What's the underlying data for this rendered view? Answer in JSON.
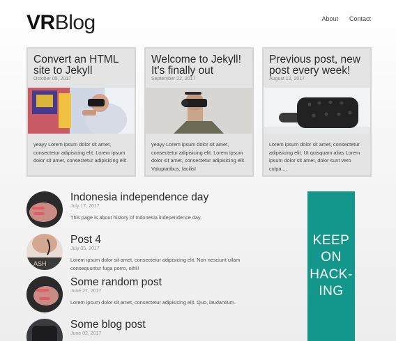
{
  "site": {
    "logo_bold": "VR",
    "logo_light": "Blog"
  },
  "nav": {
    "items": [
      "About",
      "Contact"
    ]
  },
  "featured": [
    {
      "title": "Convert an HTML site to Jekyll",
      "date": "October 05, 2017",
      "excerpt": "yeayy Lorem ipsum dolor sit amet, consectetur adipisicing elit. Lorem ipsum dolor sit amet, consectetur adipisicing elit."
    },
    {
      "title": "Welcome to Jekyll! It's finally out",
      "date": "September 22, 2017",
      "excerpt": "yeayy Lorem ipsum dolor sit amet, consectetur adipisicing elit. Lorem ipsum dolor sit amet, consectetur adipisicing elit. Voluptatibus, facilis!"
    },
    {
      "title": "Previous post, new post every week!",
      "date": "August 12, 2017",
      "excerpt": "Lorem ipsum dolor sit amet, consectetur adipisicing elit. Ut quisquam alias Lorem ipsum dolor sit amet, dolor sunt vero culpa...."
    }
  ],
  "posts": [
    {
      "title": "Indonesia independence day",
      "date": "July 17, 2017",
      "excerpt": "This page is about history of Indonesia independence day."
    },
    {
      "title": "Post 4",
      "date": "July 05, 2017",
      "excerpt": "Lorem ipsum dolor sit amet, consectetur adipisicing elit. Non nesciunt ullam consequuntur fuga porro, nihil!"
    },
    {
      "title": "Some random post",
      "date": "June 27, 2017",
      "excerpt": "Lorem ipsum dolor sit amet, consectetur adipisicing elit. Quo, laudantium."
    },
    {
      "title": "Some blog post",
      "date": "June 02, 2017",
      "excerpt": ""
    }
  ],
  "banner": {
    "lines": [
      "KEEP",
      "ON",
      "HACK-",
      "ING"
    ],
    "color": "#13978b"
  },
  "icons": [
    "vr-headset-photo",
    "avatar-photo"
  ]
}
